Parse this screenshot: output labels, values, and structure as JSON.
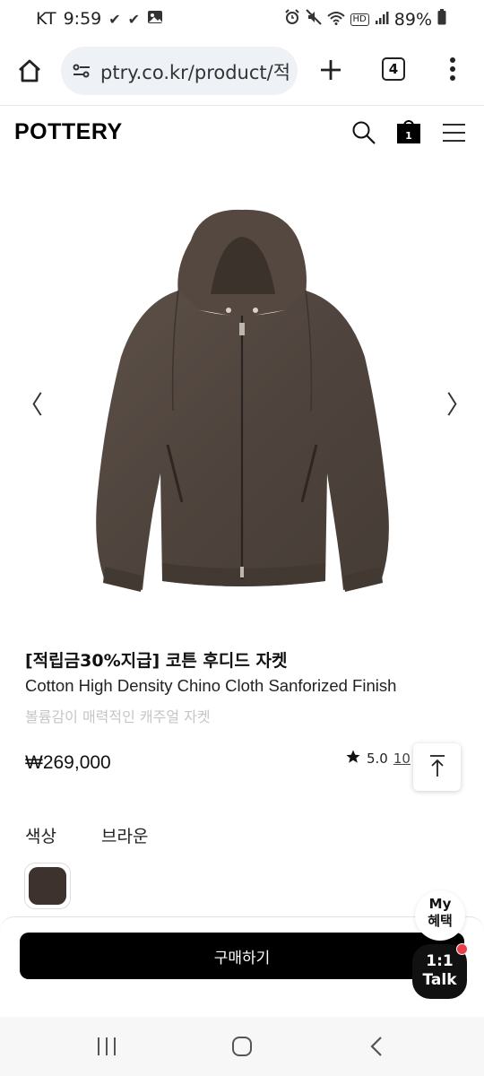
{
  "status_bar": {
    "carrier": "KT",
    "time": "9:59",
    "battery": "89%",
    "network_badge": "HD",
    "icons": [
      "check-notif-icon",
      "check-notif-icon",
      "image-notif-icon",
      "alarm-icon",
      "mute-icon",
      "wifi-icon",
      "signal-icon",
      "battery-icon"
    ]
  },
  "browser": {
    "url": "ptry.co.kr/product/적",
    "tab_count": "4",
    "icons": [
      "home-icon",
      "site-settings-icon",
      "new-tab-icon",
      "tabs-icon",
      "menu-dots-icon"
    ]
  },
  "site_header": {
    "logo": "POTTERY",
    "cart_count": "1",
    "icons": [
      "search-icon",
      "cart-icon",
      "hamburger-icon"
    ]
  },
  "carousel": {
    "prev_label": "〈",
    "next_label": "〉",
    "image_subject": "brown hooded zip-up jacket"
  },
  "product": {
    "title": "[적립금30%지급] 코튼 후디드 자켓",
    "subtitle": "Cotton High Density Chino Cloth Sanforized Finish",
    "description": "볼륨감이 매력적인 캐주얼 자켓",
    "price": "₩269,000",
    "rating": "5.0",
    "review_count": "10",
    "option_label": "색상",
    "option_value": "브라운",
    "swatch_color": "#3e322e"
  },
  "bottom_bar": {
    "buy_label": "구매하기",
    "benefit_line1": "My",
    "benefit_line2": "혜택",
    "talk_line1": "1:1",
    "talk_line2": "Talk",
    "talk_badge_color": "#e8404a"
  },
  "nav_bar": {
    "icons": [
      "recent-apps-icon",
      "home-nav-icon",
      "back-nav-icon"
    ]
  }
}
